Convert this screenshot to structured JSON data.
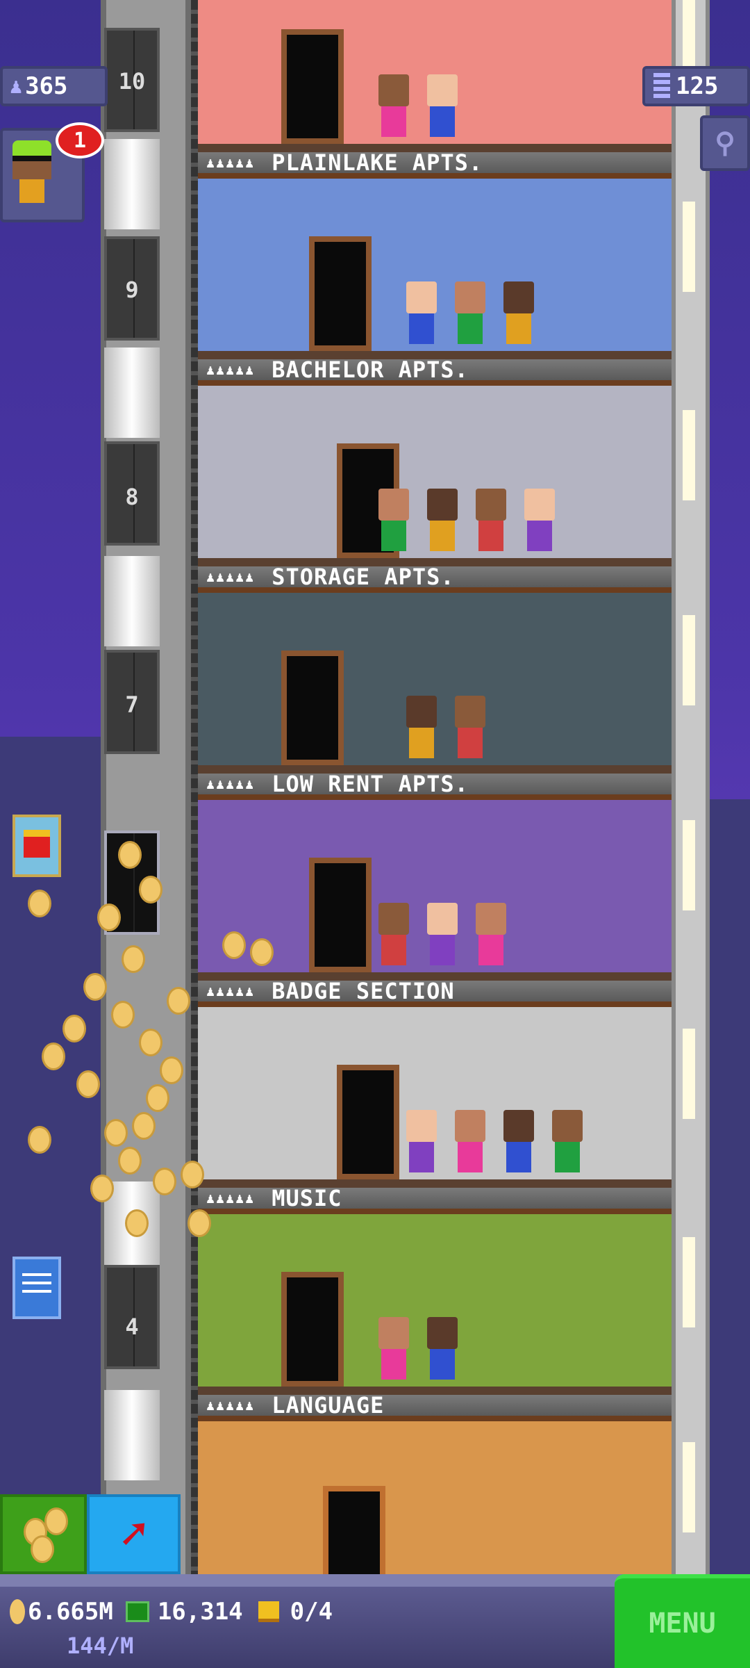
{
  "hud": {
    "population": "365",
    "floors_count": "125",
    "notification_count": "1"
  },
  "elevator": {
    "floor_numbers": [
      "10",
      "9",
      "8",
      "7",
      "4"
    ]
  },
  "floors": [
    {
      "name": "PLAINLAKE APTS.",
      "stars": "♟♟♟♟♟",
      "color": "#ee8b84"
    },
    {
      "name": "BACHELOR APTS.",
      "stars": "♟♟♟♟♟",
      "color": "#6f8fd6"
    },
    {
      "name": "STORAGE APTS.",
      "stars": "♟♟♟♟♟",
      "color": "#b4b4c2"
    },
    {
      "name": "LOW RENT APTS.",
      "stars": "♟♟♟♟♟",
      "color": "#4a5a62"
    },
    {
      "name": "BADGE SECTION",
      "stars": "♟♟♟♟♟",
      "color": "#7a5ab0"
    },
    {
      "name": "MUSIC",
      "stars": "♟♟♟♟♟",
      "color": "#c8c8c8"
    },
    {
      "name": "LANGUAGE",
      "stars": "♟♟♟♟♟",
      "color": "#7fa53c"
    }
  ],
  "bottom_room_color": "#d9964c",
  "status": {
    "coins": "6.665M",
    "coins_rate": "144/M",
    "bux": "16,314",
    "tickets": "0/4"
  },
  "menu_label": "MENU",
  "colors": {
    "menu_green": "#22c22a",
    "coin_gold": "#f1c76a",
    "bux_green": "#1a8c1a"
  }
}
